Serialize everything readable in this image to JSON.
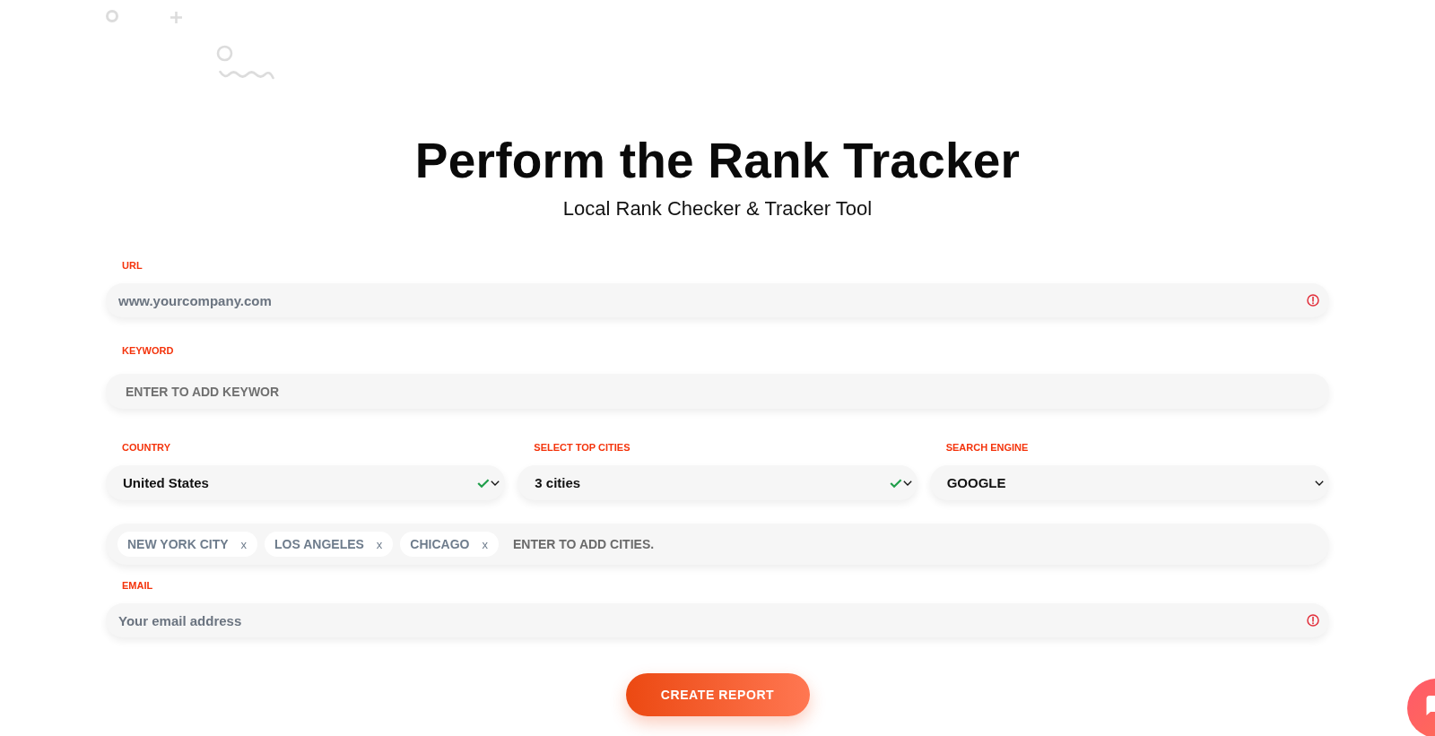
{
  "header": {
    "title": "Perform the Rank Tracker",
    "subtitle": "Local Rank Checker & Tracker Tool"
  },
  "form": {
    "url": {
      "label": "URL",
      "placeholder": "www.yourcompany.com",
      "error": true
    },
    "keyword": {
      "label": "KEYWORD",
      "placeholder": "ENTER TO ADD KEYWOR",
      "error": false
    },
    "selects": [
      {
        "label": "COUNTRY",
        "value": "United States",
        "valid": true
      },
      {
        "label": "SELECT TOP CITIES",
        "value": "3 cities",
        "valid": true
      },
      {
        "label": "SEARCH ENGINE",
        "value": "GOOGLE",
        "valid": false
      }
    ],
    "cities": {
      "tags": [
        {
          "text": "NEW YORK CITY",
          "remove": "x"
        },
        {
          "text": "LOS ANGELES",
          "remove": "x"
        },
        {
          "text": "CHICAGO",
          "remove": "x"
        }
      ],
      "placeholder": "ENTER TO ADD CITIES."
    },
    "email": {
      "label": "EMAIL",
      "placeholder": "Your email address",
      "error": true
    },
    "submit": "CREATE REPORT"
  }
}
